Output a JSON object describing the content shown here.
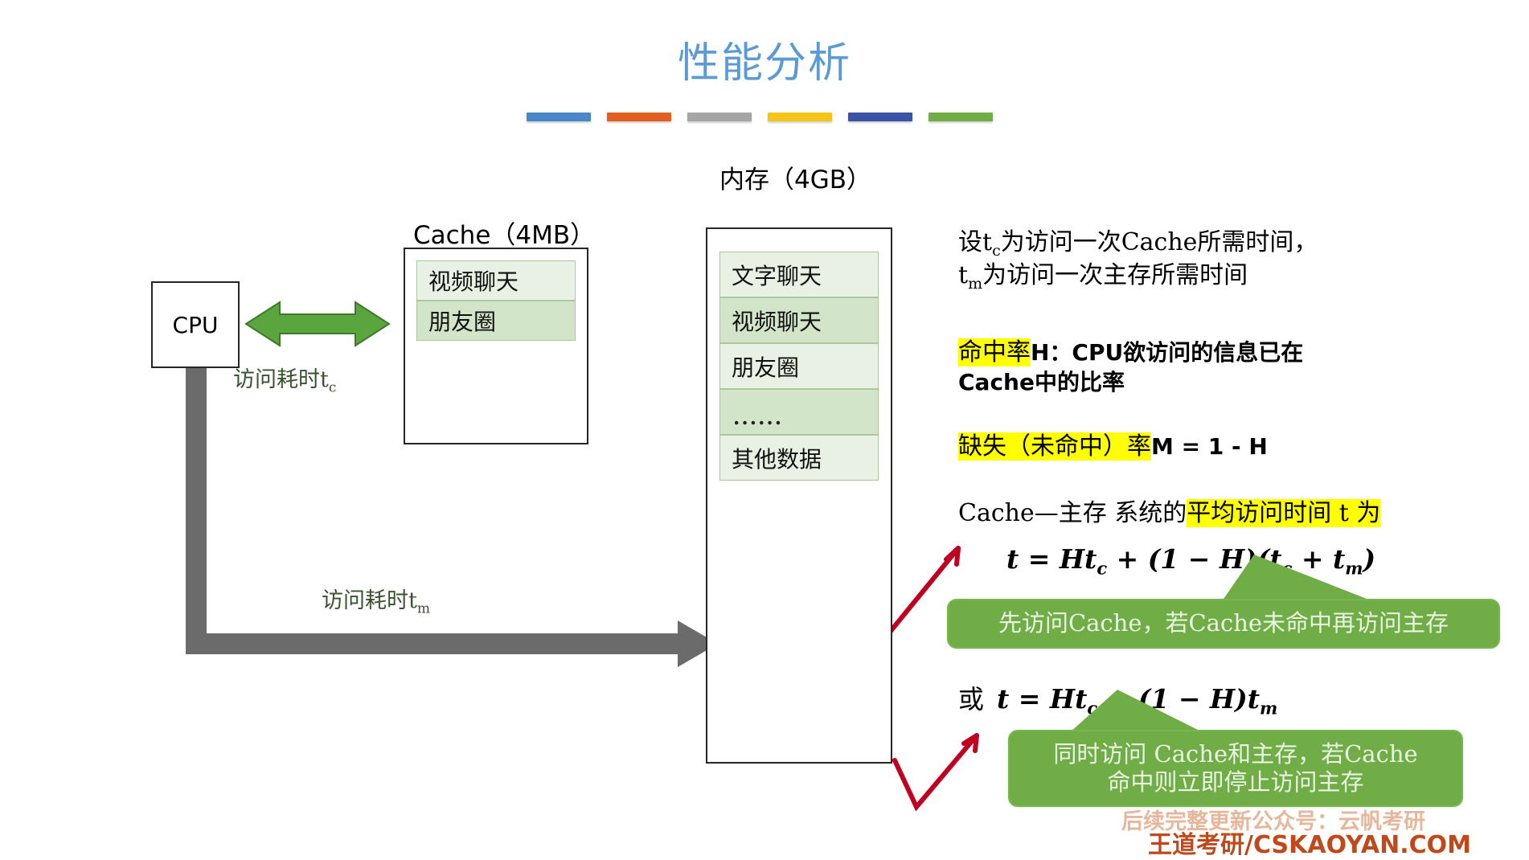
{
  "slide": {
    "title": "性能分析",
    "accent_title_color": "#5b9bd5",
    "bars": [
      {
        "name": "bar-blue",
        "color": "#4a86c8"
      },
      {
        "name": "bar-orange",
        "color": "#e2601f"
      },
      {
        "name": "bar-gray",
        "color": "#a5a5a5"
      },
      {
        "name": "bar-yellow",
        "color": "#f5c518"
      },
      {
        "name": "bar-navy",
        "color": "#3a53a4"
      },
      {
        "name": "bar-green",
        "color": "#70ad47"
      }
    ]
  },
  "diagram": {
    "cpu_label": "CPU",
    "cache": {
      "caption": "Cache（4MB）",
      "cells": [
        {
          "text": "视频聊天",
          "shade": "light"
        },
        {
          "text": "朋友圈",
          "shade": "dark"
        }
      ]
    },
    "memory": {
      "caption": "内存（4GB）",
      "cells": [
        {
          "text": "文字聊天",
          "shade": "light"
        },
        {
          "text": "视频聊天",
          "shade": "dark"
        },
        {
          "text": "朋友圈",
          "shade": "light"
        },
        {
          "text": "......",
          "shade": "dark"
        },
        {
          "text": "其他数据",
          "shade": "light"
        }
      ]
    },
    "arrow_labels": {
      "cache_access": {
        "prefix": "访问耗时t",
        "sub": "c"
      },
      "memory_access": {
        "prefix": "访问耗时t",
        "sub": "m"
      }
    },
    "arrow_colors": {
      "cpu_cache_arrow": "#5ba53f",
      "bus_arrow": "#6b6b6b",
      "annotation_arrow": "#c00020"
    }
  },
  "notes": {
    "definition": {
      "line1_a": "设t",
      "line1_sub": "c",
      "line1_b": "为访问一次Cache所需时间，",
      "line2_a": "t",
      "line2_sub": "m",
      "line2_b": "为访问一次主存所需时间"
    },
    "hit_rate": {
      "highlight": "命中率",
      "rest_line1": "H：CPU欲访问的信息已在",
      "line2": "Cache中的比率",
      "highlight_color": "#ffff00"
    },
    "miss_rate": {
      "highlight": "缺失（未命中）率",
      "rest": "M = 1 - H"
    },
    "average_time": {
      "prefix": "Cache—主存 系统的",
      "highlight": "平均访问时间 t 为"
    },
    "formula_1": {
      "lhs": "t",
      "body": " = Ht",
      "sub1": "c",
      "mid": " + (1 − H)(t",
      "sub2": "c",
      "mid2": " + t",
      "sub3": "m",
      "tail": ")",
      "full_text": "t = Htc + (1 − H)(tc + tm)"
    },
    "formula_2": {
      "or": "或",
      "full_text": "t = Htc + (1 − H)tm"
    }
  },
  "callouts": [
    {
      "name": "callout-sequential-access",
      "text": "先访问Cache，若Cache未命中再访问主存",
      "color": "#70ad47"
    },
    {
      "name": "callout-parallel-access",
      "line1": "同时访问 Cache和主存，若Cache",
      "line2": "命中则立即停止访问主存",
      "color": "#70ad47"
    }
  ],
  "watermarks": {
    "top": "后续完整更新公众号：云帆考研",
    "bottom": "王道考研/CSKAOYAN.COM",
    "bottom_color": "#c0491b"
  }
}
